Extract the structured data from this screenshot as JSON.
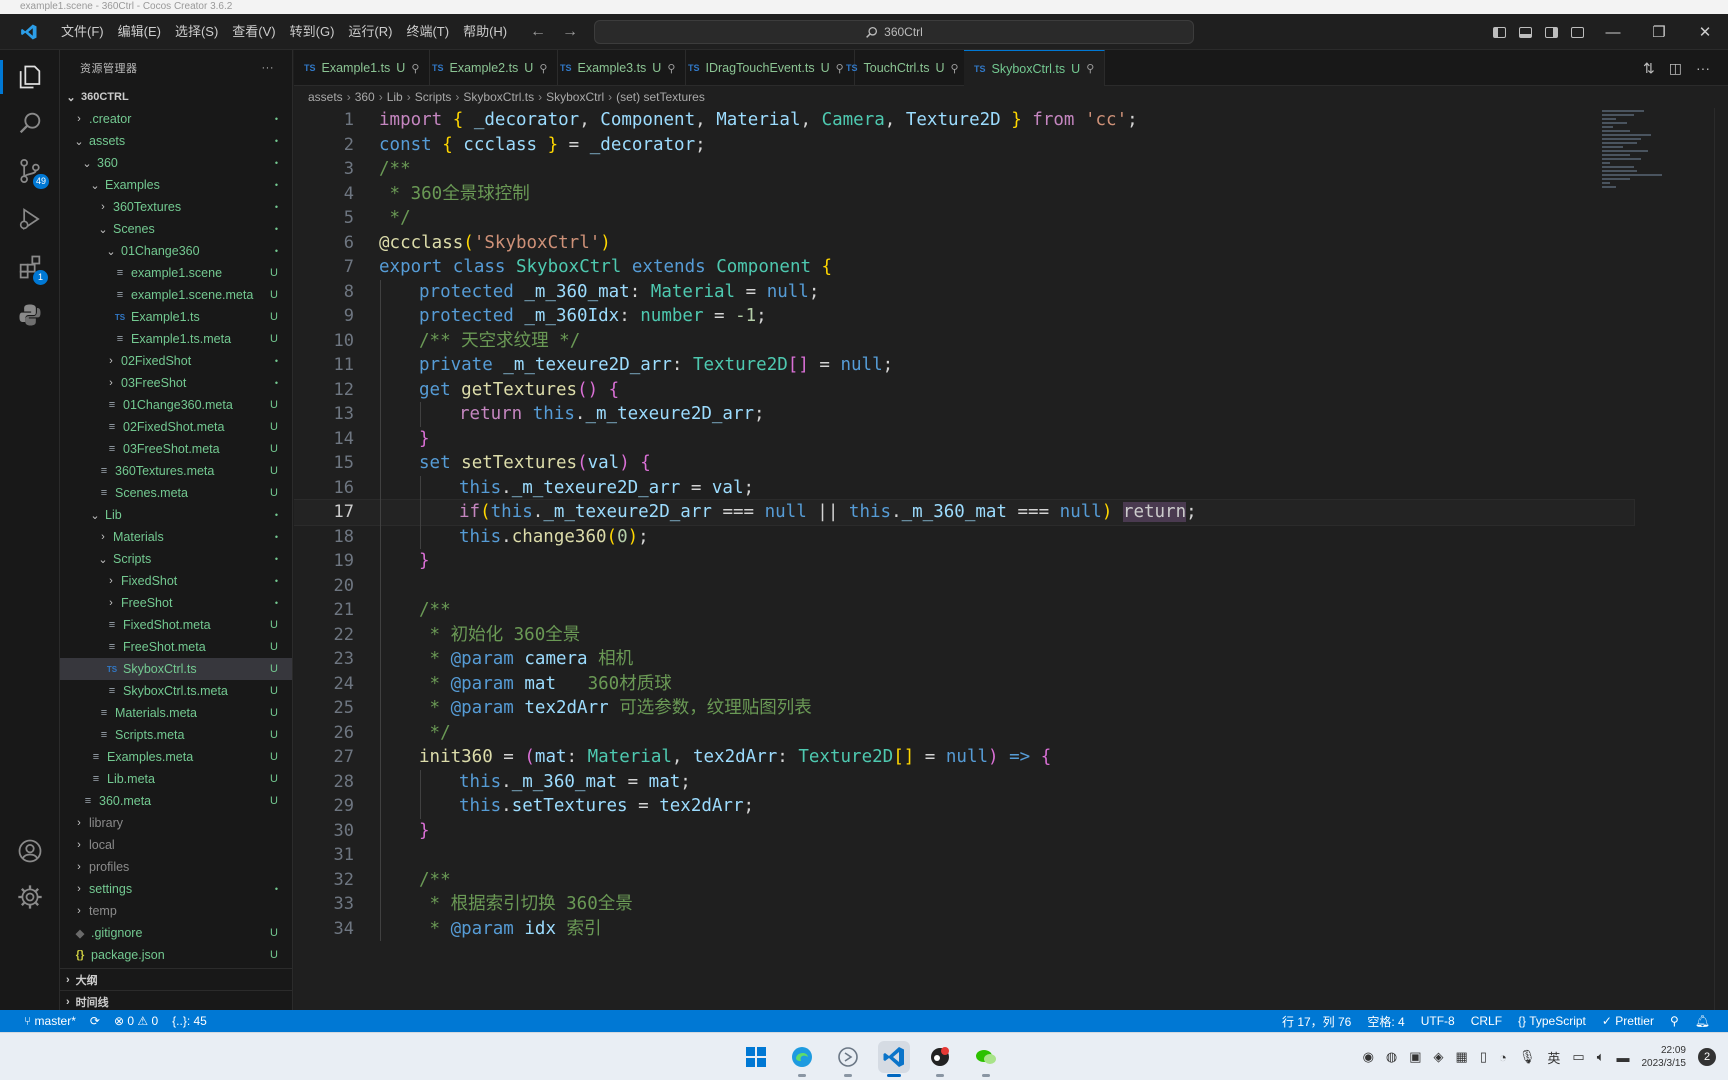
{
  "browser": {
    "tab_text": "example1.scene - 360Ctrl - Cocos Creator 3.6.2"
  },
  "window": {
    "menu": [
      "文件(F)",
      "编辑(E)",
      "选择(S)",
      "查看(V)",
      "转到(G)",
      "运行(R)",
      "终端(T)",
      "帮助(H)"
    ],
    "search": "360Ctrl"
  },
  "activity_bar": {
    "source_control_badge": "49",
    "extensions_badge": "1"
  },
  "sidebar": {
    "title": "资源管理器",
    "root": "360CTRL",
    "tree": [
      {
        "label": ".creator",
        "depth": 1,
        "kind": "folder-closed",
        "status": "•",
        "git": true
      },
      {
        "label": "assets",
        "depth": 1,
        "kind": "folder-open",
        "status": "•",
        "git": true
      },
      {
        "label": "360",
        "depth": 2,
        "kind": "folder-open",
        "status": "•",
        "git": true
      },
      {
        "label": "Examples",
        "depth": 3,
        "kind": "folder-open",
        "status": "•",
        "git": true
      },
      {
        "label": "360Textures",
        "depth": 4,
        "kind": "folder-closed",
        "status": "•",
        "git": true
      },
      {
        "label": "Scenes",
        "depth": 4,
        "kind": "folder-open",
        "status": "•",
        "git": true
      },
      {
        "label": "01Change360",
        "depth": 5,
        "kind": "folder-open",
        "status": "•",
        "git": true
      },
      {
        "label": "example1.scene",
        "depth": 6,
        "kind": "meta",
        "status": "U",
        "git": true
      },
      {
        "label": "example1.scene.meta",
        "depth": 6,
        "kind": "meta",
        "status": "U",
        "git": true
      },
      {
        "label": "Example1.ts",
        "depth": 6,
        "kind": "ts",
        "status": "U",
        "git": true
      },
      {
        "label": "Example1.ts.meta",
        "depth": 6,
        "kind": "meta",
        "status": "U",
        "git": true
      },
      {
        "label": "02FixedShot",
        "depth": 5,
        "kind": "folder-closed",
        "status": "•",
        "git": true
      },
      {
        "label": "03FreeShot",
        "depth": 5,
        "kind": "folder-closed",
        "status": "•",
        "git": true
      },
      {
        "label": "01Change360.meta",
        "depth": 5,
        "kind": "meta",
        "status": "U",
        "git": true
      },
      {
        "label": "02FixedShot.meta",
        "depth": 5,
        "kind": "meta",
        "status": "U",
        "git": true
      },
      {
        "label": "03FreeShot.meta",
        "depth": 5,
        "kind": "meta",
        "status": "U",
        "git": true
      },
      {
        "label": "360Textures.meta",
        "depth": 4,
        "kind": "meta",
        "status": "U",
        "git": true
      },
      {
        "label": "Scenes.meta",
        "depth": 4,
        "kind": "meta",
        "status": "U",
        "git": true
      },
      {
        "label": "Lib",
        "depth": 3,
        "kind": "folder-open",
        "status": "•",
        "git": true
      },
      {
        "label": "Materials",
        "depth": 4,
        "kind": "folder-closed",
        "status": "•",
        "git": true
      },
      {
        "label": "Scripts",
        "depth": 4,
        "kind": "folder-open",
        "status": "•",
        "git": true
      },
      {
        "label": "FixedShot",
        "depth": 5,
        "kind": "folder-closed",
        "status": "•",
        "git": true
      },
      {
        "label": "FreeShot",
        "depth": 5,
        "kind": "folder-closed",
        "status": "•",
        "git": true
      },
      {
        "label": "FixedShot.meta",
        "depth": 5,
        "kind": "meta",
        "status": "U",
        "git": true
      },
      {
        "label": "FreeShot.meta",
        "depth": 5,
        "kind": "meta",
        "status": "U",
        "git": true
      },
      {
        "label": "SkyboxCtrl.ts",
        "depth": 5,
        "kind": "ts",
        "status": "U",
        "git": true,
        "selected": true
      },
      {
        "label": "SkyboxCtrl.ts.meta",
        "depth": 5,
        "kind": "meta",
        "status": "U",
        "git": true
      },
      {
        "label": "Materials.meta",
        "depth": 4,
        "kind": "meta",
        "status": "U",
        "git": true
      },
      {
        "label": "Scripts.meta",
        "depth": 4,
        "kind": "meta",
        "status": "U",
        "git": true
      },
      {
        "label": "Examples.meta",
        "depth": 3,
        "kind": "meta",
        "status": "U",
        "git": true
      },
      {
        "label": "Lib.meta",
        "depth": 3,
        "kind": "meta",
        "status": "U",
        "git": true
      },
      {
        "label": "360.meta",
        "depth": 2,
        "kind": "meta",
        "status": "U",
        "git": true
      },
      {
        "label": "library",
        "depth": 1,
        "kind": "folder-closed",
        "status": "",
        "git": false
      },
      {
        "label": "local",
        "depth": 1,
        "kind": "folder-closed",
        "status": "",
        "git": false
      },
      {
        "label": "profiles",
        "depth": 1,
        "kind": "folder-closed",
        "status": "",
        "git": false
      },
      {
        "label": "settings",
        "depth": 1,
        "kind": "folder-closed",
        "status": "•",
        "git": true
      },
      {
        "label": "temp",
        "depth": 1,
        "kind": "folder-closed",
        "status": "",
        "git": false
      },
      {
        "label": ".gitignore",
        "depth": 1,
        "kind": "git",
        "status": "U",
        "git": true
      },
      {
        "label": "package.json",
        "depth": 1,
        "kind": "json",
        "status": "U",
        "git": true
      }
    ],
    "sections": [
      "大纲",
      "时间线"
    ]
  },
  "tabs": [
    {
      "label": "Example1.ts",
      "status": "U"
    },
    {
      "label": "Example2.ts",
      "status": "U"
    },
    {
      "label": "Example3.ts",
      "status": "U"
    },
    {
      "label": "IDragTouchEvent.ts",
      "status": "U"
    },
    {
      "label": "TouchCtrl.ts",
      "status": "U"
    },
    {
      "label": "SkyboxCtrl.ts",
      "status": "U",
      "active": true
    }
  ],
  "breadcrumb": [
    "assets",
    "360",
    "Lib",
    "Scripts",
    "SkyboxCtrl.ts",
    "SkyboxCtrl",
    "(set) setTextures"
  ],
  "editor": {
    "current_line": 17,
    "lines": [
      {
        "n": 1,
        "i": 0,
        "t": [
          [
            "ctl",
            "import "
          ],
          [
            "br",
            "{ "
          ],
          [
            "vr",
            "_decorator"
          ],
          [
            "op",
            ", "
          ],
          [
            "vr",
            "Component"
          ],
          [
            "op",
            ", "
          ],
          [
            "vr",
            "Material"
          ],
          [
            "op",
            ", "
          ],
          [
            "ty",
            "Camera"
          ],
          [
            "op",
            ", "
          ],
          [
            "vr",
            "Texture2D"
          ],
          [
            "br",
            " }"
          ],
          [
            "ctl",
            " from "
          ],
          [
            "str",
            "'cc'"
          ],
          [
            "op",
            ";"
          ]
        ]
      },
      {
        "n": 2,
        "i": 0,
        "t": [
          [
            "kw",
            "const "
          ],
          [
            "br",
            "{ "
          ],
          [
            "vr",
            "ccclass"
          ],
          [
            "br",
            " }"
          ],
          [
            "op",
            " = "
          ],
          [
            "vr",
            "_decorator"
          ],
          [
            "op",
            ";"
          ]
        ]
      },
      {
        "n": 3,
        "i": 0,
        "t": [
          [
            "cm",
            "/**"
          ]
        ]
      },
      {
        "n": 4,
        "i": 0,
        "t": [
          [
            "cm",
            " * 360全景球控制"
          ]
        ]
      },
      {
        "n": 5,
        "i": 0,
        "t": [
          [
            "cm",
            " */"
          ]
        ]
      },
      {
        "n": 6,
        "i": 0,
        "t": [
          [
            "fn",
            "@ccclass"
          ],
          [
            "br",
            "("
          ],
          [
            "str",
            "'SkyboxCtrl'"
          ],
          [
            "br",
            ")"
          ]
        ]
      },
      {
        "n": 7,
        "i": 0,
        "t": [
          [
            "kw",
            "export "
          ],
          [
            "kw",
            "class "
          ],
          [
            "ty",
            "SkyboxCtrl "
          ],
          [
            "kw",
            "extends "
          ],
          [
            "ty",
            "Component "
          ],
          [
            "br",
            "{"
          ]
        ]
      },
      {
        "n": 8,
        "i": 1,
        "t": [
          [
            "kw",
            "protected "
          ],
          [
            "vr",
            "_m_360_mat"
          ],
          [
            "op",
            ": "
          ],
          [
            "ty",
            "Material"
          ],
          [
            "op",
            " = "
          ],
          [
            "kw",
            "null"
          ],
          [
            "op",
            ";"
          ]
        ]
      },
      {
        "n": 9,
        "i": 1,
        "t": [
          [
            "kw",
            "protected "
          ],
          [
            "vr",
            "_m_360Idx"
          ],
          [
            "op",
            ": "
          ],
          [
            "ty",
            "number"
          ],
          [
            "op",
            " = "
          ],
          [
            "num",
            "-1"
          ],
          [
            "op",
            ";"
          ]
        ]
      },
      {
        "n": 10,
        "i": 1,
        "t": [
          [
            "cm",
            "/** 天空求纹理 */"
          ]
        ]
      },
      {
        "n": 11,
        "i": 1,
        "t": [
          [
            "kw",
            "private "
          ],
          [
            "vr",
            "_m_texeure2D_arr"
          ],
          [
            "op",
            ": "
          ],
          [
            "ty",
            "Texture2D"
          ],
          [
            "br2",
            "[]"
          ],
          [
            "op",
            " = "
          ],
          [
            "kw",
            "null"
          ],
          [
            "op",
            ";"
          ]
        ]
      },
      {
        "n": 12,
        "i": 1,
        "t": [
          [
            "kw",
            "get "
          ],
          [
            "fn",
            "getTextures"
          ],
          [
            "br2",
            "() {"
          ]
        ]
      },
      {
        "n": 13,
        "i": 2,
        "t": [
          [
            "ctl",
            "return "
          ],
          [
            "kw",
            "this"
          ],
          [
            "op",
            "."
          ],
          [
            "vr",
            "_m_texeure2D_arr"
          ],
          [
            "op",
            ";"
          ]
        ]
      },
      {
        "n": 14,
        "i": 1,
        "t": [
          [
            "br2",
            "}"
          ]
        ]
      },
      {
        "n": 15,
        "i": 1,
        "t": [
          [
            "kw",
            "set "
          ],
          [
            "fn",
            "setTextures"
          ],
          [
            "br2",
            "("
          ],
          [
            "vr",
            "val"
          ],
          [
            "br2",
            ") {"
          ]
        ]
      },
      {
        "n": 16,
        "i": 2,
        "t": [
          [
            "kw",
            "this"
          ],
          [
            "op",
            "."
          ],
          [
            "vr",
            "_m_texeure2D_arr"
          ],
          [
            "op",
            " = "
          ],
          [
            "vr",
            "val"
          ],
          [
            "op",
            ";"
          ]
        ]
      },
      {
        "n": 17,
        "i": 2,
        "t": [
          [
            "ctl",
            "if"
          ],
          [
            "br",
            "("
          ],
          [
            "kw",
            "this"
          ],
          [
            "op",
            "."
          ],
          [
            "vr",
            "_m_texeure2D_arr"
          ],
          [
            "op",
            " === "
          ],
          [
            "kw",
            "null"
          ],
          [
            "op",
            " || "
          ],
          [
            "kw",
            "this"
          ],
          [
            "op",
            "."
          ],
          [
            "vr",
            "_m_360_mat"
          ],
          [
            "op",
            " === "
          ],
          [
            "kw",
            "null"
          ],
          [
            "br",
            ")"
          ],
          [
            "op",
            " "
          ],
          [
            "sel",
            "return"
          ],
          [
            "op",
            ";"
          ]
        ]
      },
      {
        "n": 18,
        "i": 2,
        "t": [
          [
            "kw",
            "this"
          ],
          [
            "op",
            "."
          ],
          [
            "fn",
            "change360"
          ],
          [
            "br",
            "("
          ],
          [
            "num",
            "0"
          ],
          [
            "br",
            ")"
          ],
          [
            "op",
            ";"
          ]
        ]
      },
      {
        "n": 19,
        "i": 1,
        "t": [
          [
            "br2",
            "}"
          ]
        ]
      },
      {
        "n": 20,
        "i": 0,
        "t": []
      },
      {
        "n": 21,
        "i": 1,
        "t": [
          [
            "cm",
            "/**"
          ]
        ]
      },
      {
        "n": 22,
        "i": 1,
        "t": [
          [
            "cm",
            " * 初始化 360全景"
          ]
        ]
      },
      {
        "n": 23,
        "i": 1,
        "t": [
          [
            "cm",
            " * "
          ],
          [
            "doc",
            "@param "
          ],
          [
            "vr",
            "camera "
          ],
          [
            "cm",
            "相机"
          ]
        ]
      },
      {
        "n": 24,
        "i": 1,
        "t": [
          [
            "cm",
            " * "
          ],
          [
            "doc",
            "@param "
          ],
          [
            "vr",
            "mat   "
          ],
          [
            "cm",
            "360材质球"
          ]
        ]
      },
      {
        "n": 25,
        "i": 1,
        "t": [
          [
            "cm",
            " * "
          ],
          [
            "doc",
            "@param "
          ],
          [
            "vr",
            "tex2dArr "
          ],
          [
            "cm",
            "可选参数，纹理贴图列表"
          ]
        ]
      },
      {
        "n": 26,
        "i": 1,
        "t": [
          [
            "cm",
            " */"
          ]
        ]
      },
      {
        "n": 27,
        "i": 1,
        "t": [
          [
            "fn",
            "init360"
          ],
          [
            "op",
            " = "
          ],
          [
            "br2",
            "("
          ],
          [
            "vr",
            "mat"
          ],
          [
            "op",
            ": "
          ],
          [
            "ty",
            "Material"
          ],
          [
            "op",
            ", "
          ],
          [
            "vr",
            "tex2dArr"
          ],
          [
            "op",
            ": "
          ],
          [
            "ty",
            "Texture2D"
          ],
          [
            "br",
            "[]"
          ],
          [
            "op",
            " = "
          ],
          [
            "kw",
            "null"
          ],
          [
            "br2",
            ")"
          ],
          [
            "kw",
            " => "
          ],
          [
            "br2",
            "{"
          ]
        ]
      },
      {
        "n": 28,
        "i": 2,
        "t": [
          [
            "kw",
            "this"
          ],
          [
            "op",
            "."
          ],
          [
            "vr",
            "_m_360_mat"
          ],
          [
            "op",
            " = "
          ],
          [
            "vr",
            "mat"
          ],
          [
            "op",
            ";"
          ]
        ]
      },
      {
        "n": 29,
        "i": 2,
        "t": [
          [
            "kw",
            "this"
          ],
          [
            "op",
            "."
          ],
          [
            "vr",
            "setTextures"
          ],
          [
            "op",
            " = "
          ],
          [
            "vr",
            "tex2dArr"
          ],
          [
            "op",
            ";"
          ]
        ]
      },
      {
        "n": 30,
        "i": 1,
        "t": [
          [
            "br2",
            "}"
          ]
        ]
      },
      {
        "n": 31,
        "i": 0,
        "t": []
      },
      {
        "n": 32,
        "i": 1,
        "t": [
          [
            "cm",
            "/**"
          ]
        ]
      },
      {
        "n": 33,
        "i": 1,
        "t": [
          [
            "cm",
            " * 根据索引切换 360全景"
          ]
        ]
      },
      {
        "n": 34,
        "i": 1,
        "t": [
          [
            "cm",
            " * "
          ],
          [
            "doc",
            "@param "
          ],
          [
            "vr",
            "idx "
          ],
          [
            "cm",
            "索引"
          ]
        ]
      }
    ]
  },
  "statusbar": {
    "branch": "master*",
    "errors": "0",
    "warnings": "0",
    "ports": "{..}: 45",
    "cursor": "行 17，列 76",
    "spaces": "空格: 4",
    "encoding": "UTF-8",
    "eol": "CRLF",
    "language": "TypeScript",
    "formatter": "Prettier"
  },
  "taskbar": {
    "time": "22:09",
    "date": "2023/3/15",
    "notifications": "2",
    "ime": "英"
  },
  "colors": {
    "accent": "#0078d4",
    "untracked": "#73c991",
    "keyword": "#569cd6",
    "control": "#c586c0",
    "type": "#4ec9b0",
    "string": "#ce9178"
  }
}
